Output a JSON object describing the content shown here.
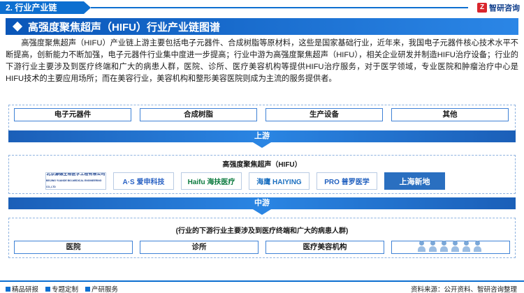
{
  "header": {
    "section_label": "2. 行业产业链",
    "logo_text": "智研咨询",
    "logo_mark": "Z"
  },
  "title": "高强度聚焦超声（HIFU）行业产业链图谱",
  "intro": "高强度聚焦超声（HIFU）产业链上游主要包括电子元器件、合成树脂等原材料，这些是国家基础行业，近年来，我国电子元器件核心技术水平不断提高，创新能力不断加强，电子元器件行业集中度进一步提高；行业中游为高强度聚焦超声（HIFU），相关企业研发并制造HIFU治疗设备；行业的下游行业主要涉及到医疗终端和广大的病患人群，医院、诊所、医疗美容机构等提供HIFU治疗服务，对于医学领域，专业医院和肿瘤治疗中心是HIFU技术的主要应用场所；而在美容行业，美容机构和整形美容医院则成为主流的服务提供者。",
  "upstream": {
    "items": [
      "电子元器件",
      "合成树脂",
      "生产设备",
      "其他"
    ],
    "banner": "上游"
  },
  "midstream": {
    "label": "高强度聚焦超声（HIFU）",
    "companies": [
      {
        "name": "北京源德生物医学工程有限公司",
        "sub": "BEIJING YUANDE BIO-MEDICAL ENGINEERING CO.,LTD",
        "color": "#1a3f8c"
      },
      {
        "name": "A·S 爱申科技",
        "color": "#2a62c4"
      },
      {
        "name": "Haifu 海扶医疗",
        "color": "#0b7a3e"
      },
      {
        "name": "海鹰 HAIYING",
        "color": "#1a6fc0"
      },
      {
        "name": "PRO 普罗医学",
        "color": "#1f5fbf"
      },
      {
        "name": "上海新地",
        "color": "#ffffff",
        "bg": "#2a6fc0"
      }
    ],
    "banner": "中游"
  },
  "downstream": {
    "label": "(行业的下游行业主要涉及到医疗终端和广大的病患人群)",
    "items": [
      "医院",
      "诊所",
      "医疗美容机构"
    ]
  },
  "footer": {
    "left": [
      "精品研报",
      "专题定制",
      "产研服务"
    ],
    "source": "资料来源：公开资料、智研咨询整理"
  },
  "colors": {
    "brand": "#0d6fd0",
    "accent_red": "#d9262d"
  }
}
